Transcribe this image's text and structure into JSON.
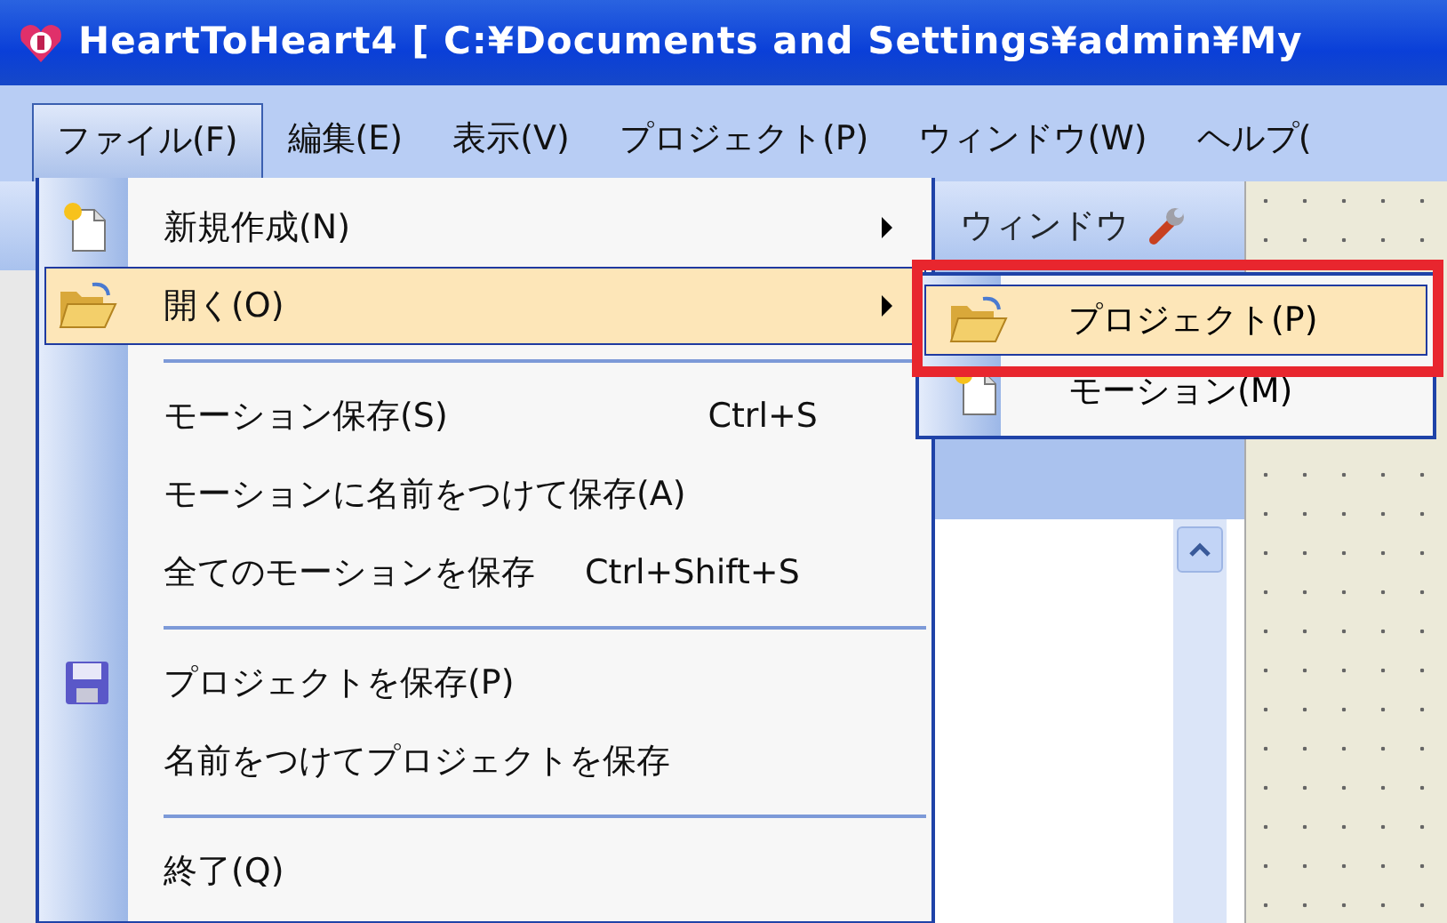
{
  "window": {
    "title": "HeartToHeart4 [ C:¥Documents and Settings¥admin¥My"
  },
  "menu_bar": [
    {
      "label": "ファイル(F)",
      "selected": true
    },
    {
      "label": "編集(E)",
      "selected": false
    },
    {
      "label": "表示(V)",
      "selected": false
    },
    {
      "label": "プロジェクト(P)",
      "selected": false
    },
    {
      "label": "ウィンドウ(W)",
      "selected": false
    },
    {
      "label": "ヘルプ(",
      "selected": false
    }
  ],
  "toolbar": {
    "label": "ウィンドウ"
  },
  "file_menu": [
    {
      "kind": "item",
      "label": "新規作成(N)",
      "has_submenu": true,
      "selected": false
    },
    {
      "kind": "item",
      "label": "開く(O)",
      "has_submenu": true,
      "selected": true
    },
    {
      "kind": "separator"
    },
    {
      "kind": "item",
      "label": "モーション保存(S)",
      "shortcut": "Ctrl+S",
      "selected": false
    },
    {
      "kind": "item",
      "label": "モーションに名前をつけて保存(A)",
      "selected": false
    },
    {
      "kind": "item",
      "label": "全てのモーションを保存",
      "shortcut": "Ctrl+Shift+S",
      "selected": false
    },
    {
      "kind": "separator"
    },
    {
      "kind": "item",
      "label": "プロジェクトを保存(P)",
      "selected": false
    },
    {
      "kind": "item",
      "label": "名前をつけてプロジェクトを保存",
      "selected": false
    },
    {
      "kind": "separator"
    },
    {
      "kind": "item",
      "label": "終了(Q)",
      "selected": false
    }
  ],
  "open_submenu": [
    {
      "label": "プロジェクト(P)",
      "selected": true,
      "highlighted": true
    },
    {
      "label": "モーション(M)",
      "selected": false,
      "highlighted": false
    }
  ]
}
